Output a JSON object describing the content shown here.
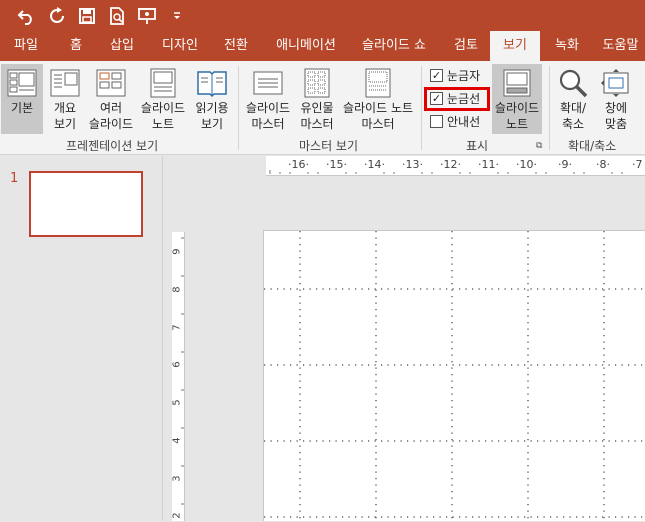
{
  "qat": {
    "buttons": [
      "undo-icon",
      "redo-icon",
      "save-icon",
      "print-preview-icon",
      "present-icon",
      "customize-icon"
    ]
  },
  "tabs": {
    "file": "파일",
    "home": "홈",
    "insert": "삽입",
    "design": "디자인",
    "transitions": "전환",
    "animations": "애니메이션",
    "slideshow": "슬라이드 쇼",
    "review": "검토",
    "view": "보기",
    "record": "녹화",
    "help": "도움말"
  },
  "ribbon": {
    "presentation_views": {
      "normal": "기본",
      "outline": [
        "개요",
        "보기"
      ],
      "slide_sorter": [
        "여러",
        "슬라이드"
      ],
      "notes_page": [
        "슬라이드",
        "노트"
      ],
      "reading_view": [
        "읽기용",
        "보기"
      ],
      "group_label": "프레젠테이션 보기"
    },
    "master_views": {
      "slide_master": [
        "슬라이드",
        "마스터"
      ],
      "handout_master": [
        "유인물",
        "마스터"
      ],
      "notes_master": [
        "슬라이드 노트",
        "마스터"
      ],
      "group_label": "마스터 보기"
    },
    "show": {
      "ruler": "눈금자",
      "gridlines": "눈금선",
      "guides": "안내선",
      "ruler_checked": true,
      "gridlines_checked": true,
      "guides_checked": false,
      "notes": [
        "슬라이드",
        "노트"
      ],
      "group_label": "표시"
    },
    "zoom": {
      "zoom": [
        "확대/",
        "축소"
      ],
      "fit_to_window": [
        "창에",
        "맞춤"
      ],
      "group_label": "확대/축소"
    }
  },
  "thumbnails": {
    "slide_number": "1"
  },
  "rulers": {
    "horizontal": [
      "·16·",
      "·15·",
      "·14·",
      "·13·",
      "·12·",
      "·11·",
      "·10·",
      "·9·",
      "·8·",
      "·7"
    ],
    "vertical": [
      "9",
      "8",
      "7",
      "6",
      "5",
      "4",
      "3",
      "2"
    ]
  },
  "colors": {
    "accent": "#b7472a",
    "highlight_box": "#e00000"
  }
}
